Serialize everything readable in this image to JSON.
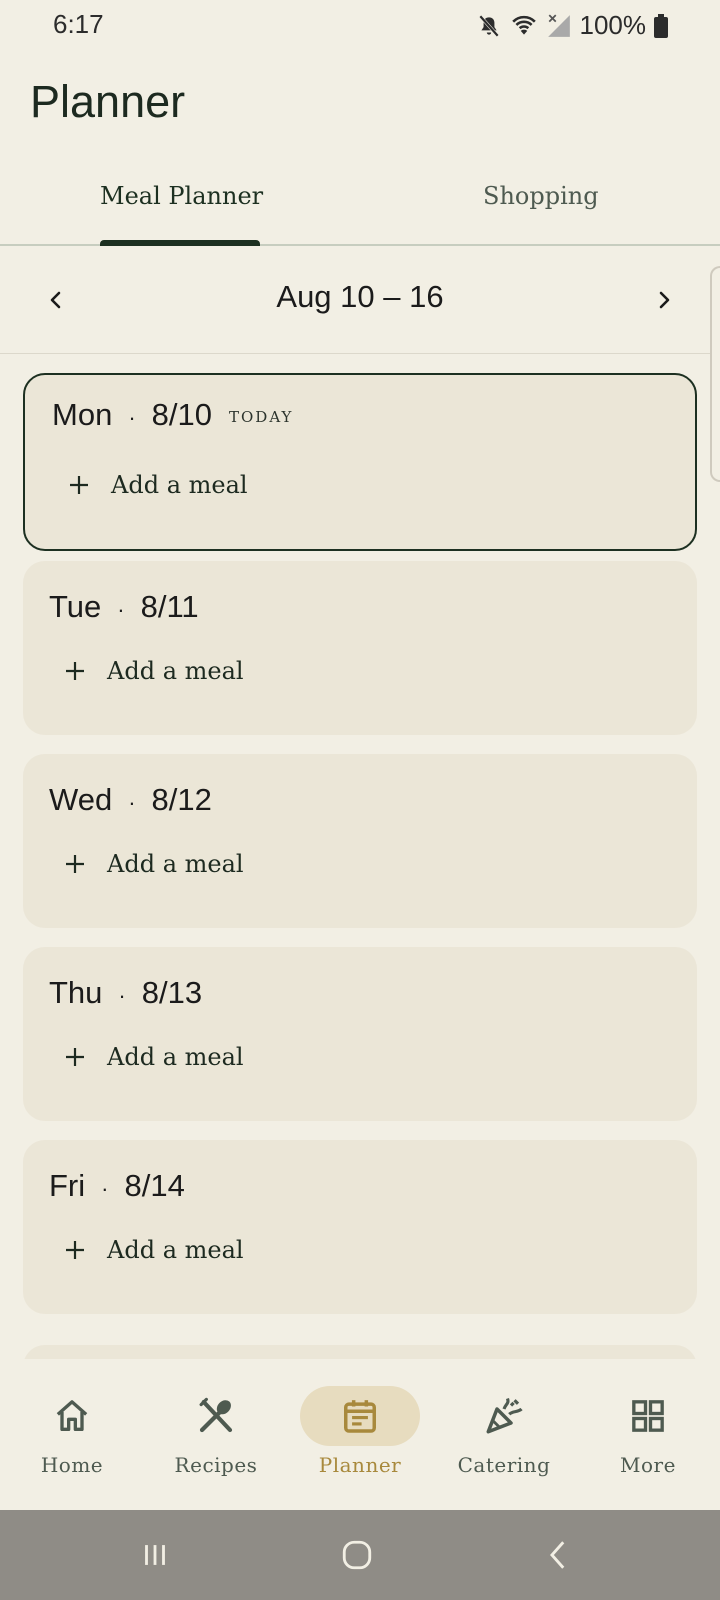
{
  "status_bar": {
    "time": "6:17",
    "battery": "100%"
  },
  "page": {
    "title": "Planner"
  },
  "tabs": [
    {
      "label": "Meal Planner",
      "active": true
    },
    {
      "label": "Shopping",
      "active": false
    }
  ],
  "week_nav": {
    "label": "Aug 10 – 16"
  },
  "days": [
    {
      "day": "Mon",
      "date": "8/10",
      "badge": "TODAY",
      "add_label": "Add a meal"
    },
    {
      "day": "Tue",
      "date": "8/11",
      "add_label": "Add a meal"
    },
    {
      "day": "Wed",
      "date": "8/12",
      "add_label": "Add a meal"
    },
    {
      "day": "Thu",
      "date": "8/13",
      "add_label": "Add a meal"
    },
    {
      "day": "Fri",
      "date": "8/14",
      "add_label": "Add a meal"
    }
  ],
  "day_separator": "·",
  "bottom_nav": [
    {
      "label": "Home",
      "icon": "home-icon"
    },
    {
      "label": "Recipes",
      "icon": "utensils-icon"
    },
    {
      "label": "Planner",
      "icon": "calendar-icon",
      "active": true
    },
    {
      "label": "Catering",
      "icon": "party-popper-icon"
    },
    {
      "label": "More",
      "icon": "grid-icon"
    }
  ],
  "colors": {
    "background": "#f2efe4",
    "card": "#ebe6d7",
    "accent_dark": "#1d3021",
    "active_nav": "#a8893c",
    "active_nav_pill": "#e7dcbf"
  }
}
